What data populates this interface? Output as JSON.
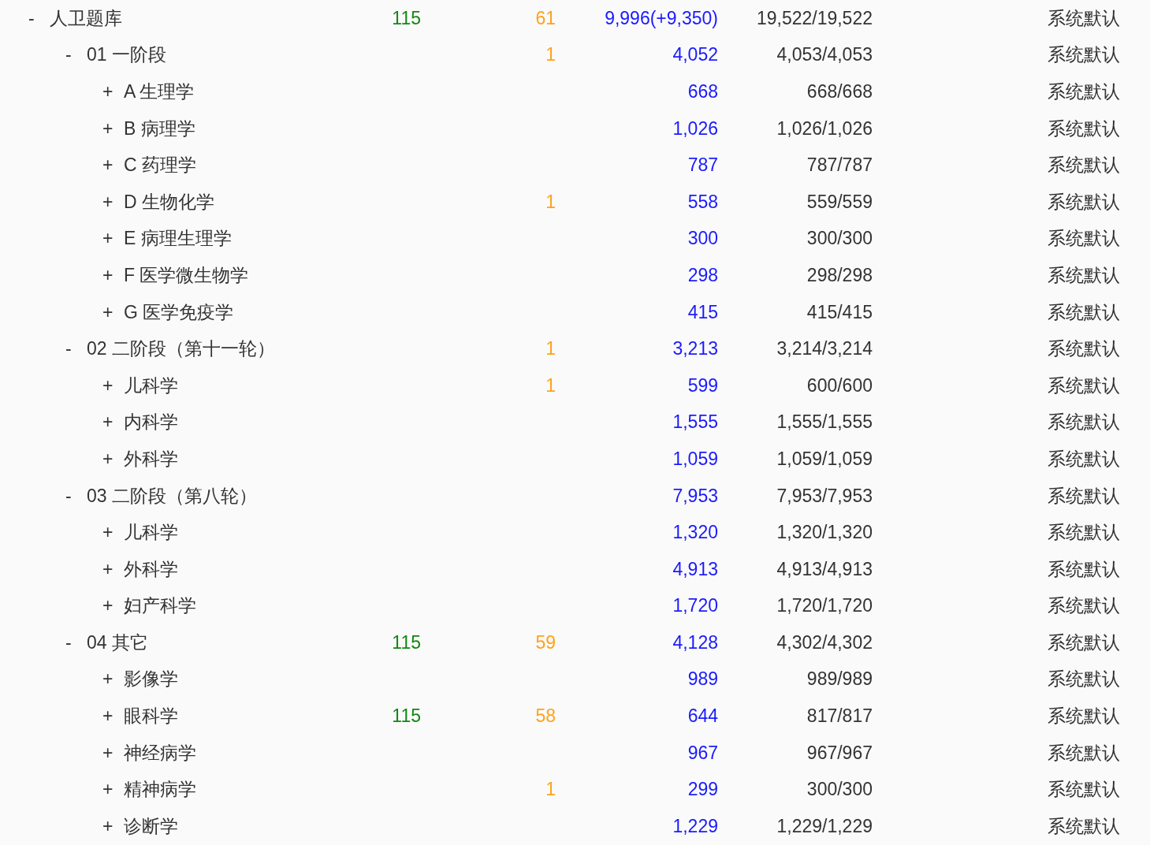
{
  "tree": [
    {
      "toggle": "-",
      "name": "人卫题库",
      "column_2": "115",
      "column_3": "61",
      "column_4": "9,996(+9,350)",
      "column_5": "19,522/19,522",
      "column_6": "系统默认",
      "children": [
        {
          "toggle": "-",
          "name": "01 一阶段",
          "column_3": "1",
          "column_4": "4,052",
          "column_5": "4,053/4,053",
          "column_6": "系统默认",
          "children": [
            {
              "toggle": "+",
              "name": "A 生理学",
              "column_4": "668",
              "column_5": "668/668",
              "column_6": "系统默认"
            },
            {
              "toggle": "+",
              "name": "B 病理学",
              "column_4": "1,026",
              "column_5": "1,026/1,026",
              "column_6": "系统默认"
            },
            {
              "toggle": "+",
              "name": "C 药理学",
              "column_4": "787",
              "column_5": "787/787",
              "column_6": "系统默认"
            },
            {
              "toggle": "+",
              "name": "D 生物化学",
              "column_3": "1",
              "column_4": "558",
              "column_5": "559/559",
              "column_6": "系统默认"
            },
            {
              "toggle": "+",
              "name": "E 病理生理学",
              "column_4": "300",
              "column_5": "300/300",
              "column_6": "系统默认"
            },
            {
              "toggle": "+",
              "name": "F 医学微生物学",
              "column_4": "298",
              "column_5": "298/298",
              "column_6": "系统默认"
            },
            {
              "toggle": "+",
              "name": "G 医学免疫学",
              "column_4": "415",
              "column_5": "415/415",
              "column_6": "系统默认"
            }
          ]
        },
        {
          "toggle": "-",
          "name": "02 二阶段（第十一轮）",
          "column_3": "1",
          "column_4": "3,213",
          "column_5": "3,214/3,214",
          "column_6": "系统默认",
          "children": [
            {
              "toggle": "+",
              "name": "儿科学",
              "column_3": "1",
              "column_4": "599",
              "column_5": "600/600",
              "column_6": "系统默认"
            },
            {
              "toggle": "+",
              "name": "内科学",
              "column_4": "1,555",
              "column_5": "1,555/1,555",
              "column_6": "系统默认"
            },
            {
              "toggle": "+",
              "name": "外科学",
              "column_4": "1,059",
              "column_5": "1,059/1,059",
              "column_6": "系统默认"
            }
          ]
        },
        {
          "toggle": "-",
          "name": "03 二阶段（第八轮）",
          "column_4": "7,953",
          "column_5": "7,953/7,953",
          "column_6": "系统默认",
          "children": [
            {
              "toggle": "+",
              "name": "儿科学",
              "column_4": "1,320",
              "column_5": "1,320/1,320",
              "column_6": "系统默认"
            },
            {
              "toggle": "+",
              "name": "外科学",
              "column_4": "4,913",
              "column_5": "4,913/4,913",
              "column_6": "系统默认"
            },
            {
              "toggle": "+",
              "name": "妇产科学",
              "column_4": "1,720",
              "column_5": "1,720/1,720",
              "column_6": "系统默认"
            }
          ]
        },
        {
          "toggle": "-",
          "name": "04 其它",
          "column_2": "115",
          "column_3": "59",
          "column_4": "4,128",
          "column_5": "4,302/4,302",
          "column_6": "系统默认",
          "children": [
            {
              "toggle": "+",
              "name": "影像学",
              "column_4": "989",
              "column_5": "989/989",
              "column_6": "系统默认"
            },
            {
              "toggle": "+",
              "name": "眼科学",
              "column_2": "115",
              "column_3": "58",
              "column_4": "644",
              "column_5": "817/817",
              "column_6": "系统默认"
            },
            {
              "toggle": "+",
              "name": "神经病学",
              "column_4": "967",
              "column_5": "967/967",
              "column_6": "系统默认"
            },
            {
              "toggle": "+",
              "name": "精神病学",
              "column_3": "1",
              "column_4": "299",
              "column_5": "300/300",
              "column_6": "系统默认"
            },
            {
              "toggle": "+",
              "name": "诊断学",
              "column_4": "1,229",
              "column_5": "1,229/1,229",
              "column_6": "系统默认"
            }
          ]
        }
      ]
    }
  ]
}
